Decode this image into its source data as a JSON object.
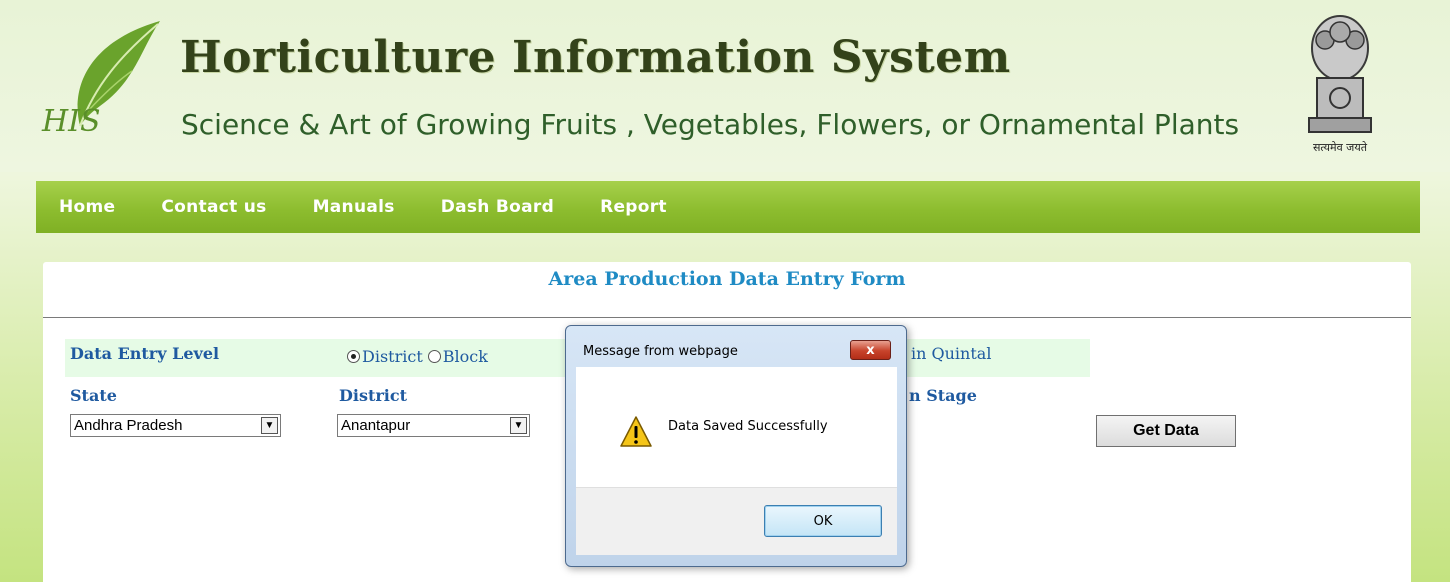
{
  "header": {
    "logo_text": "HIS",
    "title": "Horticulture Information System",
    "subtitle": "Science & Art of Growing Fruits , Vegetables, Flowers, or Ornamental Plants",
    "emblem_caption": "सत्यमेव जयते"
  },
  "nav": {
    "items": [
      "Home",
      "Contact us",
      "Manuals",
      "Dash Board",
      "Report"
    ]
  },
  "form": {
    "title": "Area Production Data Entry Form",
    "data_entry_level_label": "Data Entry Level",
    "level_options": [
      {
        "label": "District",
        "selected": true
      },
      {
        "label": "Block",
        "selected": false
      }
    ],
    "unit_partial": "in Quintal",
    "state_label": "State",
    "state_value": "Andhra Pradesh",
    "district_label": "District",
    "district_value": "Anantapur",
    "stage_partial": "n Stage",
    "get_data_label": "Get Data"
  },
  "dialog": {
    "title": "Message from webpage",
    "close_label": "x",
    "message": "Data Saved Successfully",
    "ok_label": "OK",
    "icon": "warning-icon"
  },
  "colors": {
    "nav_green": "#8dbd2f",
    "title_blue": "#1f8bc4",
    "label_blue": "#1f5aa0",
    "level_row_bg": "#e6fbe6"
  }
}
